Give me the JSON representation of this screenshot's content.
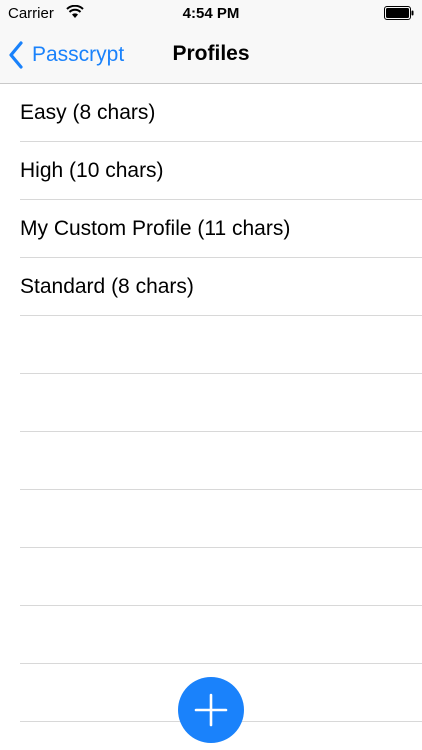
{
  "status_bar": {
    "carrier": "Carrier",
    "time": "4:54 PM"
  },
  "nav": {
    "back_label": "Passcrypt",
    "title": "Profiles"
  },
  "profiles": [
    {
      "label": "Easy (8 chars)"
    },
    {
      "label": "High (10 chars)"
    },
    {
      "label": "My Custom Profile (11 chars)"
    },
    {
      "label": "Standard (8 chars)"
    }
  ],
  "colors": {
    "accent": "#1a82fb",
    "nav_bg": "#f8f8f8",
    "separator": "#d8d8d8"
  },
  "icons": {
    "wifi": "wifi-icon",
    "battery": "battery-icon",
    "back": "chevron-left-icon",
    "add": "plus-icon"
  }
}
